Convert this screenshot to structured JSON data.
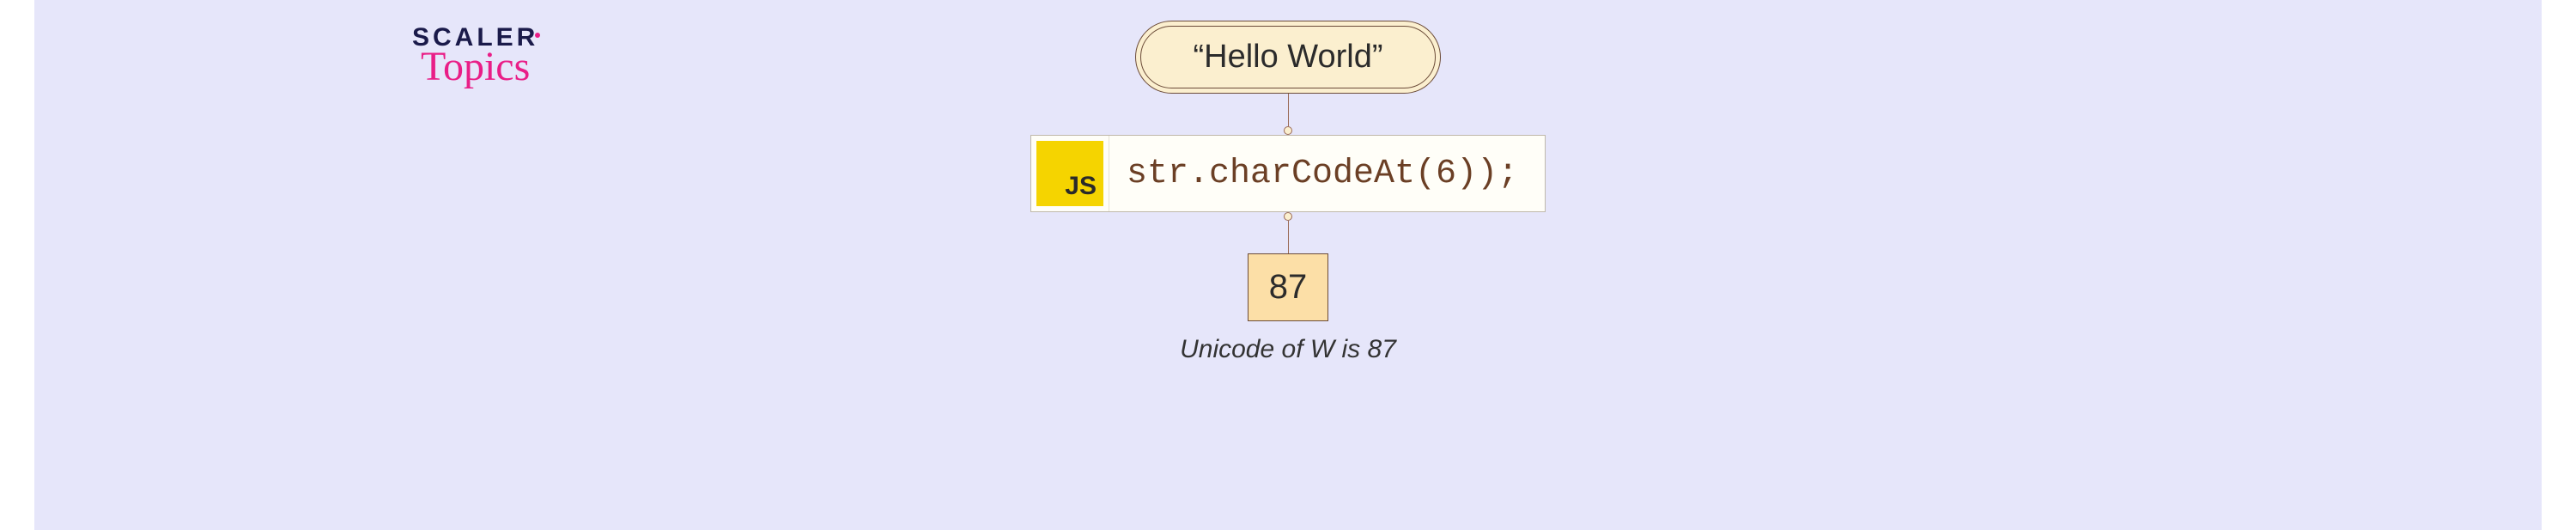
{
  "logo": {
    "line1": "SCALER",
    "line2": "Topics"
  },
  "input_string": "“Hello World”",
  "js_badge": "JS",
  "code_expression": "str.charCodeAt(6));",
  "result_value": "87",
  "caption": "Unicode of W is 87",
  "chart_data": {
    "type": "diagram",
    "input": "Hello World",
    "operation": "str.charCodeAt(6)",
    "index": 6,
    "character": "W",
    "output": 87,
    "note": "Unicode of W is 87"
  }
}
